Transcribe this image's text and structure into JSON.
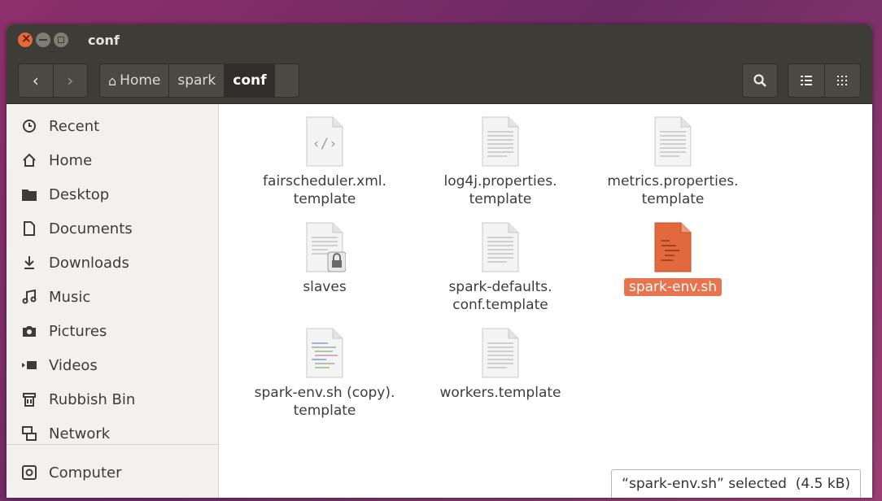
{
  "window": {
    "title": "conf"
  },
  "toolbar": {
    "breadcrumbs": [
      {
        "label": "Home",
        "icon": "home-icon"
      },
      {
        "label": "spark"
      },
      {
        "label": "conf"
      }
    ]
  },
  "sidebar": {
    "items": [
      {
        "label": "Recent",
        "icon": "clock-icon"
      },
      {
        "label": "Home",
        "icon": "home-icon"
      },
      {
        "label": "Desktop",
        "icon": "folder-icon"
      },
      {
        "label": "Documents",
        "icon": "document-icon"
      },
      {
        "label": "Downloads",
        "icon": "download-icon"
      },
      {
        "label": "Music",
        "icon": "music-icon"
      },
      {
        "label": "Pictures",
        "icon": "camera-icon"
      },
      {
        "label": "Videos",
        "icon": "video-icon"
      },
      {
        "label": "Rubbish Bin",
        "icon": "trash-icon"
      },
      {
        "label": "Network",
        "icon": "network-icon"
      },
      {
        "label": "Computer",
        "icon": "computer-icon"
      }
    ]
  },
  "files": [
    {
      "name": "fairscheduler.xml.\ntemplate",
      "icon": "xml-file-icon"
    },
    {
      "name": "log4j.properties.\ntemplate",
      "icon": "text-file-icon"
    },
    {
      "name": "metrics.properties.\ntemplate",
      "icon": "text-file-icon"
    },
    {
      "name": "slaves",
      "icon": "locked-text-file-icon"
    },
    {
      "name": "spark-defaults.\nconf.template",
      "icon": "text-file-icon"
    },
    {
      "name": "spark-env.sh",
      "icon": "script-file-icon",
      "selected": true
    },
    {
      "name": "spark-env.sh (copy).\ntemplate",
      "icon": "script-text-file-icon"
    },
    {
      "name": "workers.template",
      "icon": "text-file-icon"
    }
  ],
  "status": {
    "text": "“spark-env.sh” selected  (4.5 kB)"
  },
  "colors": {
    "accent": "#e9734e",
    "titlebar": "#3d3c37",
    "sidebar": "#f2f1f0"
  }
}
